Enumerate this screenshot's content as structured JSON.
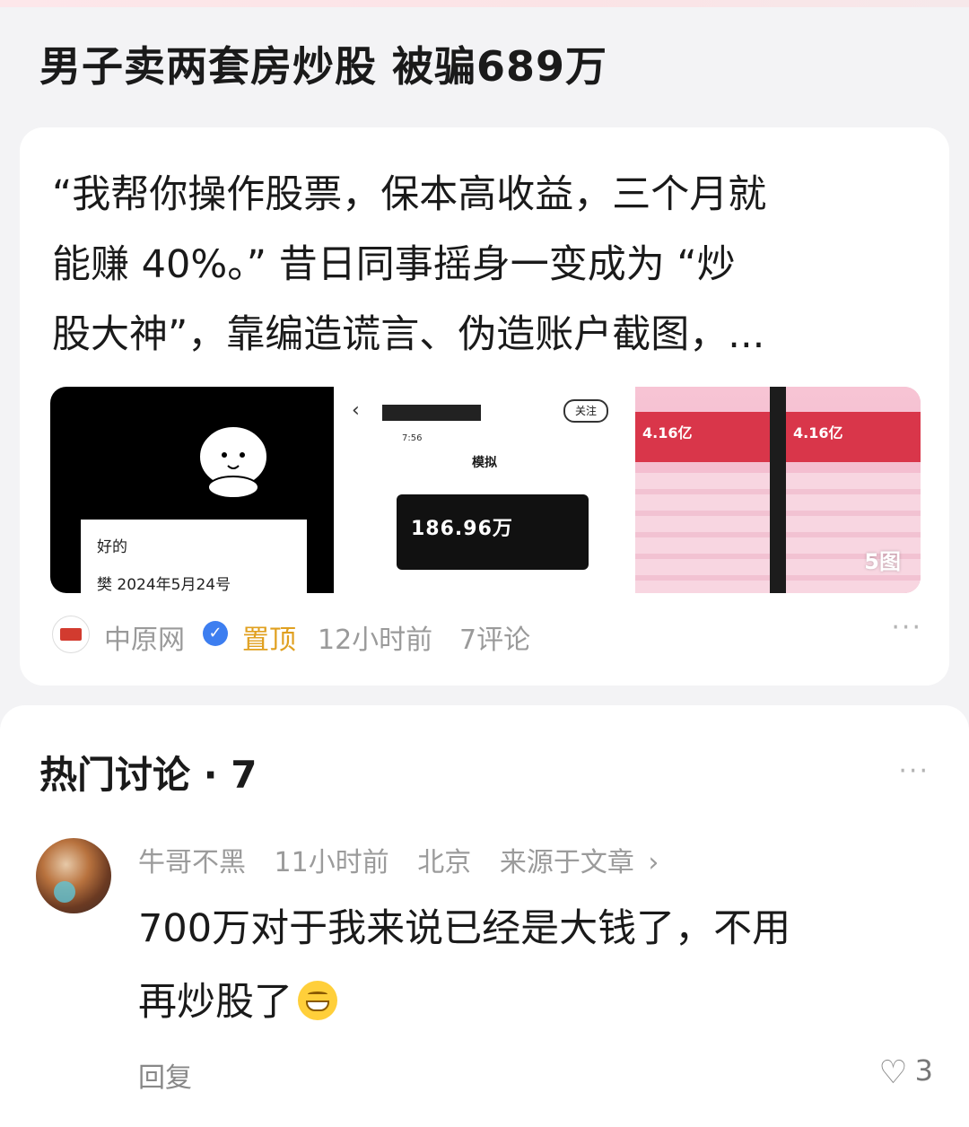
{
  "article": {
    "headline": "男子卖两套房炒股 被骗689万",
    "summary_lines": [
      "“我帮你操作股票，保本高收益，三个月就",
      "能赚 40%。” 昔日同事摇身一变成为 “炒",
      "股大神”，靠编造谎言、伪造账户截图，..."
    ],
    "thumbnails": {
      "img1_text1": "好的",
      "img1_text2": "樊   2024年5月24号",
      "img2_time": "7:56",
      "img2_follow": "关注",
      "img2_title": "模拟",
      "img2_amount": "186.96万",
      "img3_amount_left": "4.16亿",
      "img3_amount_right": "4.16亿",
      "count_label": "5图"
    },
    "source": {
      "name": "中原网",
      "pinned_label": "置顶",
      "time": "12小时前",
      "comments": "7评论"
    }
  },
  "discussion": {
    "title": "热门讨论 · 7",
    "comment": {
      "username": "牛哥不黑",
      "time": "11小时前",
      "location": "北京",
      "source": "来源于文章",
      "text_line1": "700万对于我来说已经是大钱了，不用",
      "text_line2": "再炒股了",
      "reply_label": "回复",
      "likes": "3"
    }
  },
  "colors": {
    "accent_pinned": "#e0a020",
    "verified_badge": "#3d7ef0",
    "muted_text": "#9a9a9a"
  },
  "icons": [
    "verified-icon",
    "more-icon",
    "heart-icon",
    "grin-emoji-icon",
    "chevron-right-icon",
    "source-logo"
  ]
}
